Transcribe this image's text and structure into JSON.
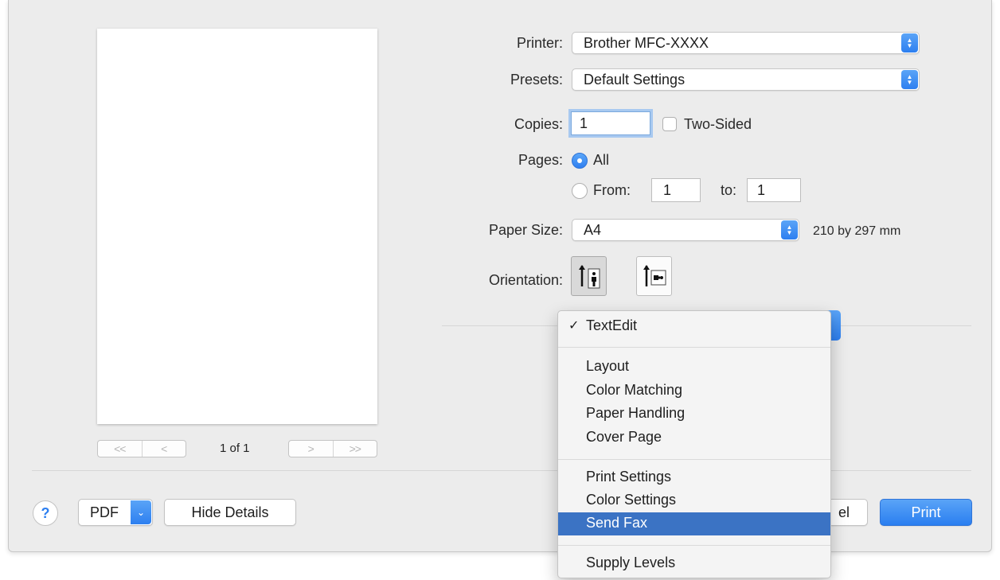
{
  "printer": {
    "label": "Printer:",
    "value": "Brother MFC-XXXX"
  },
  "presets": {
    "label": "Presets:",
    "value": "Default Settings"
  },
  "copies": {
    "label": "Copies:",
    "value": "1",
    "two_sided_label": "Two-Sided",
    "two_sided_checked": false
  },
  "pages": {
    "label": "Pages:",
    "all_label": "All",
    "from_label": "From:",
    "from_value": "1",
    "to_label": "to:",
    "to_value": "1",
    "selected": "All"
  },
  "paper_size": {
    "label": "Paper Size:",
    "value": "A4",
    "dimensions": "210 by 297 mm"
  },
  "orientation": {
    "label": "Orientation:",
    "selected": "portrait"
  },
  "preview": {
    "page_count": "1 of 1",
    "nav_first": "<<",
    "nav_prev": "<",
    "nav_next": ">",
    "nav_last": ">>"
  },
  "footer": {
    "help": "?",
    "pdf_label": "PDF",
    "hide_details_label": "Hide Details",
    "cancel_fragment": "el",
    "print_label": "Print"
  },
  "menu": {
    "checkmark": "✓",
    "checked_item": "TextEdit",
    "group1": [
      "Layout",
      "Color Matching",
      "Paper Handling",
      "Cover Page"
    ],
    "group2": [
      "Print Settings",
      "Color Settings",
      "Send Fax"
    ],
    "group3": [
      "Supply Levels"
    ],
    "highlighted": "Send Fax"
  },
  "colors": {
    "accent": "#2d7ff0",
    "menu_highlight": "#3b73c4",
    "dialog_bg": "#ececec"
  }
}
